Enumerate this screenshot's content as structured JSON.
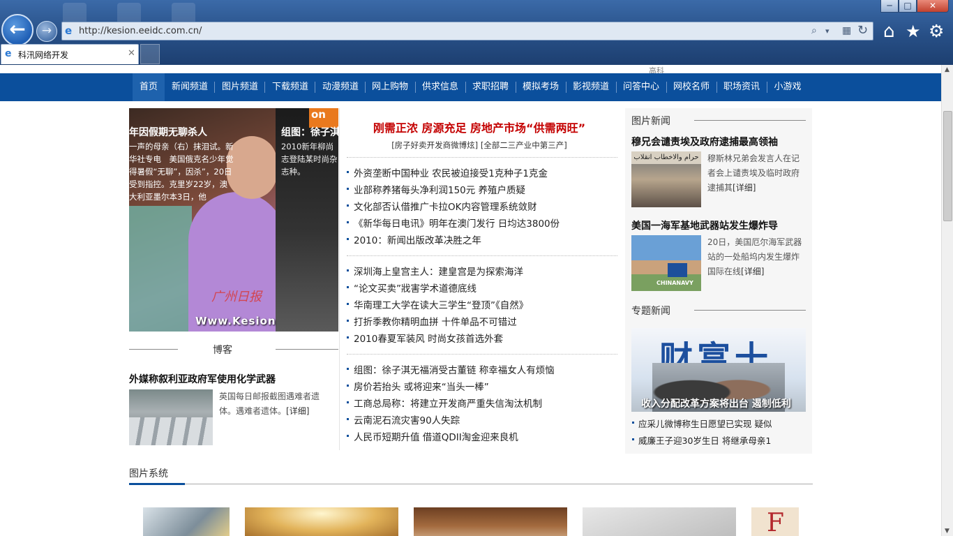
{
  "browser": {
    "url": "http://kesion.eeidc.com.cn/",
    "tab_title": "科汛网络开发",
    "window_buttons": {
      "minimize": "─",
      "maximize": "□",
      "close": "✕"
    },
    "icons": {
      "back": "←",
      "forward": "→",
      "search": "⌕",
      "dropdown": "▾",
      "compat": "▦",
      "refresh": "↻",
      "home": "⌂",
      "favorites": "★",
      "tools": "⚙",
      "tab_close": "✕"
    }
  },
  "page": {
    "top_clip": "高科",
    "nav": [
      "首页",
      "新闻频道",
      "图片频道",
      "下载频道",
      "动漫频道",
      "网上购物",
      "供求信息",
      "求职招聘",
      "模拟考场",
      "影视频道",
      "问答中心",
      "网校名师",
      "职场资讯",
      "小游戏"
    ],
    "slide": {
      "a_title": "年因假期无聊杀人",
      "a_text": "一声的母亲（右）抹泪试。新华社专电　美国俄克名少年觉得暑假“无聊”，因杀”，20日受到指控。克里岁22岁，澳大利亚墨尔本3日，他",
      "b_title": "组图：徐子淇",
      "b_text": "2010新年柳尚志登陆某时尚杂志种。",
      "orange_label": "on",
      "watermark": "Www.Kesion",
      "stamp": "广州日报"
    },
    "blog": {
      "title": "博客",
      "headline": "外媒称叙利亚政府军使用化学武器",
      "text": "英国每日邮报截图遇难者遗体。遇难者遗体。",
      "detail": "[详细]"
    },
    "middle": {
      "headline": "刚需正浓 房源充足 房地产市场“供需两旺”",
      "sub": "[房子好卖开发商微博炫] [全部二三产业中第三产]",
      "group1": [
        "外资垄断中国种业 农民被迫接受1克种子1克金",
        "业部称养猪每头净利润150元 养殖户质疑",
        "文化部否认借推广卡拉OK内容管理系统敛财",
        "《新华每日电讯》明年在澳门发行 日均达3800份",
        "2010：新闻出版改革决胜之年"
      ],
      "group2": [
        "深圳海上皇宫主人：建皇宫是为探索海洋",
        "“论文买卖”戕害学术道德底线",
        "华南理工大学在读大三学生“登顶”《自然》",
        "打折季教你精明血拼 十件单品不可错过",
        "2010春夏军装风 时尚女孩首选外套"
      ],
      "group3": [
        "组图：徐子淇无福消受古董链 称幸福女人有烦恼",
        "房价若抬头 或将迎来“当头一棒”",
        "工商总局称：将建立开发商严重失信淘汰机制",
        "云南泥石流灾害90人失踪",
        "人民币短期升值 借道QDII淘金迎来良机"
      ]
    },
    "right": {
      "pic_news_title": "图片新闻",
      "item1": {
        "headline": "穆兄会谴责埃及政府逮捕最高领袖",
        "text": "穆斯林兄弟会发言人在记者会上谴责埃及临时政府逮捕其",
        "detail": "[详细]",
        "img_sign": "حرام والاخطاب انقلاب"
      },
      "item2": {
        "headline": "美国一海军基地武器站发生爆炸导",
        "text": "20日，美国厄尔海军武器站的一处船坞内发生爆炸国际在线",
        "detail": "[详细]",
        "img_caption": "CHINANAVY"
      },
      "topic_title": "专题新闻",
      "topic_big": "财富十",
      "topic_caption": "收入分配改革方案将出台 遏制低利",
      "topic_list": [
        "应采儿微博称生日愿望已实现 疑似",
        "威廉王子迎30岁生日 将继承母亲1"
      ]
    },
    "pics_title": "图片系统",
    "pics_thumb_letter": "F"
  }
}
